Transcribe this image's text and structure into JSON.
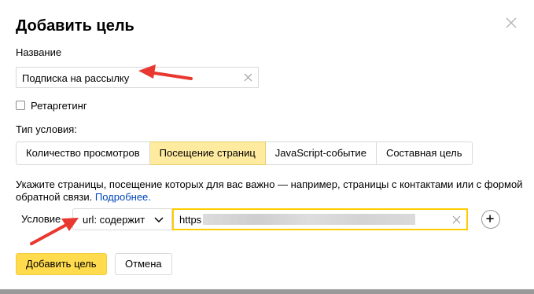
{
  "dialog": {
    "title": "Добавить цель",
    "name_label": "Название",
    "name_value": "Подписка на рассылку",
    "retargeting_label": "Ретаргетинг",
    "condition_type_label": "Тип условия:",
    "tabs": [
      {
        "label": "Количество просмотров",
        "active": false
      },
      {
        "label": "Посещение страниц",
        "active": true
      },
      {
        "label": "JavaScript-событие",
        "active": false
      },
      {
        "label": "Составная цель",
        "active": false
      }
    ],
    "hint_text": "Укажите страницы, посещение которых для вас важно — например, страницы с контактами или с формой обратной связи.",
    "hint_link": "Подробнее.",
    "condition_label": "Условие",
    "condition_select": "url: содержит",
    "url_value": "https",
    "submit_label": "Добавить цель",
    "cancel_label": "Отмена"
  },
  "colors": {
    "accent": "#ffdb4d",
    "active_tab": "#ffeba0",
    "focus_border": "#ffcc00",
    "link": "#0044bb",
    "annotation_arrow": "#e8382f"
  },
  "icons": [
    "close-icon",
    "clear-icon",
    "chevron-down-icon",
    "plus-icon"
  ]
}
